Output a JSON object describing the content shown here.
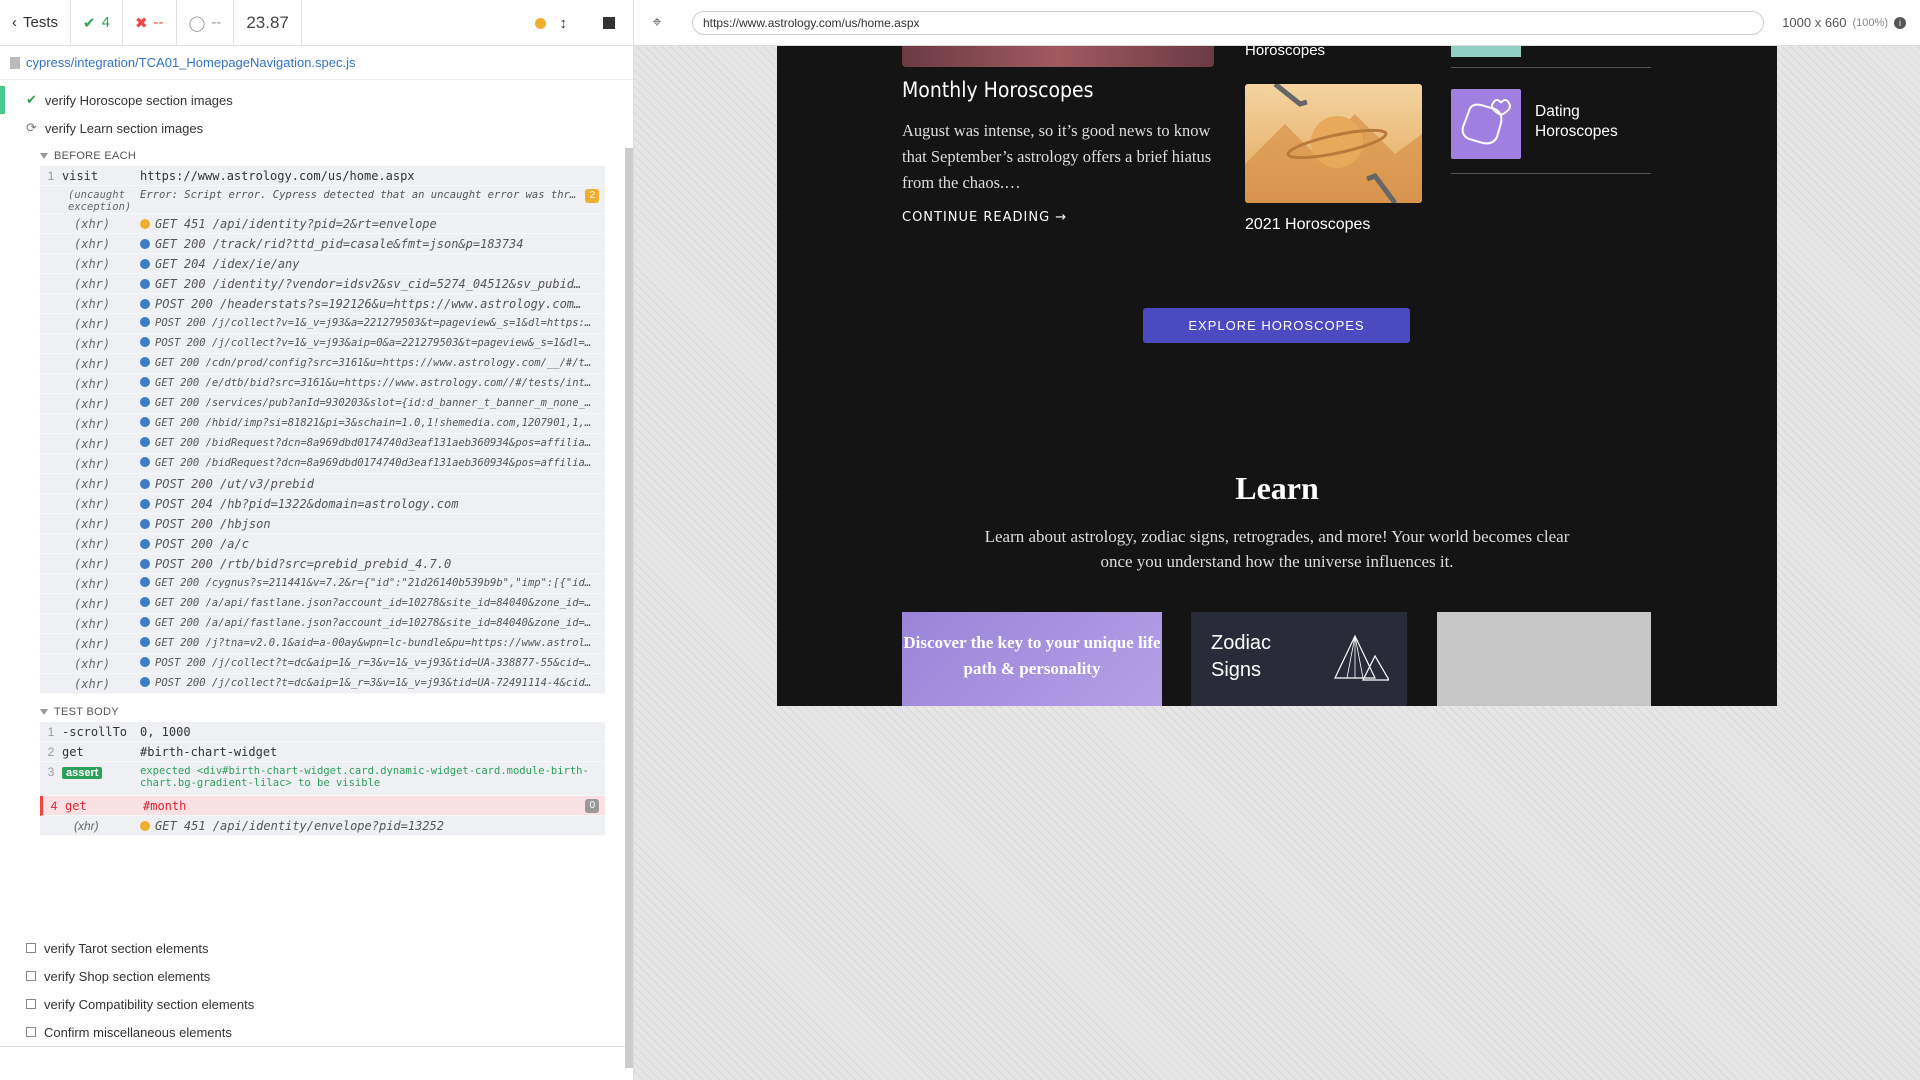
{
  "runner": {
    "tests_label": "Tests",
    "passed": "4",
    "failed": "--",
    "pending": "--",
    "duration": "23.87",
    "spec_file": "cypress/integration/TCA01_HomepageNavigation.spec.js"
  },
  "suites": {
    "passed_test": "verify Horoscope section images",
    "running_test": "verify Learn section images",
    "before_each_label": "BEFORE EACH",
    "test_body_label": "TEST BODY"
  },
  "before_each": [
    {
      "num": "1",
      "name": "visit",
      "msg": "https://www.astrology.com/us/home.aspx",
      "type": "cmd"
    },
    {
      "num": "",
      "name": "(uncaught exception)",
      "msg": "Error: Script error. Cypress detected that an uncaught error was throw…",
      "badge": "2",
      "type": "exc"
    },
    {
      "name": "(xhr)",
      "msg": "GET 451 /api/identity?pid=2&rt=envelope",
      "dot": "orange",
      "type": "xhr"
    },
    {
      "name": "(xhr)",
      "msg": "GET 200 /track/rid?ttd_pid=casale&fmt=json&p=183734",
      "dot": "blue",
      "type": "xhr"
    },
    {
      "name": "(xhr)",
      "msg": "GET 204 /idex/ie/any",
      "dot": "blue",
      "type": "xhr"
    },
    {
      "name": "(xhr)",
      "msg": "GET 200 /identity/?vendor=idsv2&sv_cid=5274_04512&sv_pubid…",
      "dot": "blue",
      "type": "xhr"
    },
    {
      "name": "(xhr)",
      "msg": "POST 200 /headerstats?s=192126&u=https://www.astrology.com…",
      "dot": "blue",
      "type": "xhr"
    },
    {
      "name": "(xhr)",
      "msg": "POST 200 /j/collect?v=1&_v=j93&a=221279503&t=pageview&_s=1&dl=https:/…",
      "dot": "blue",
      "type": "xhr-small"
    },
    {
      "name": "(xhr)",
      "msg": "POST 200 /j/collect?v=1&_v=j93&aip=0&a=221279503&t=pageview&_s=1&dl=h…",
      "dot": "blue",
      "type": "xhr-small"
    },
    {
      "name": "(xhr)",
      "msg": "GET 200 /cdn/prod/config?src=3161&u=https://www.astrology.com/__/#/te…",
      "dot": "blue",
      "type": "xhr-small"
    },
    {
      "name": "(xhr)",
      "msg": "GET 200 /e/dtb/bid?src=3161&u=https://www.astrology.com//#/tests/inte…",
      "dot": "blue",
      "type": "xhr-small"
    },
    {
      "name": "(xhr)",
      "msg": "GET 200 /services/pub?anId=930203&slot={id:d_banner_t_banner_m_none_1…",
      "dot": "blue",
      "type": "xhr-small"
    },
    {
      "name": "(xhr)",
      "msg": "GET 200 /hbid/imp?si=81821&pi=3&schain=1.0,1!shemedia.com,1207901,1,…",
      "dot": "blue",
      "type": "xhr-small"
    },
    {
      "name": "(xhr)",
      "msg": "GET 200 /bidRequest?dcn=8a969dbd0174740d3eaf131aeb360934&pos=affiliat…",
      "dot": "blue",
      "type": "xhr-small"
    },
    {
      "name": "(xhr)",
      "msg": "GET 200 /bidRequest?dcn=8a969dbd0174740d3eaf131aeb360934&pos=affiliat…",
      "dot": "blue",
      "type": "xhr-small"
    },
    {
      "name": "(xhr)",
      "msg": "POST 200 /ut/v3/prebid",
      "dot": "blue",
      "type": "xhr"
    },
    {
      "name": "(xhr)",
      "msg": "POST 204 /hb?pid=1322&domain=astrology.com",
      "dot": "blue",
      "type": "xhr"
    },
    {
      "name": "(xhr)",
      "msg": "POST 200 /hbjson",
      "dot": "blue",
      "type": "xhr"
    },
    {
      "name": "(xhr)",
      "msg": "POST 200 /a/c",
      "dot": "blue",
      "type": "xhr"
    },
    {
      "name": "(xhr)",
      "msg": "POST 200 /rtb/bid?src=prebid_prebid_4.7.0",
      "dot": "blue",
      "type": "xhr"
    },
    {
      "name": "(xhr)",
      "msg": "GET 200 /cygnus?s=211441&v=7.2&r={\"id\":\"21d26140b539b9b\",\"imp\":[{\"id\"…",
      "dot": "blue",
      "type": "xhr-small"
    },
    {
      "name": "(xhr)",
      "msg": "GET 200 /a/api/fastlane.json?account_id=10278&site_id=84040&zone_id=7…",
      "dot": "blue",
      "type": "xhr-small"
    },
    {
      "name": "(xhr)",
      "msg": "GET 200 /a/api/fastlane.json?account_id=10278&site_id=84040&zone_id=7…",
      "dot": "blue",
      "type": "xhr-small"
    },
    {
      "name": "(xhr)",
      "msg": "GET 200 /j?tna=v2.0.1&aid=a-00ay&wpn=lc-bundle&pu=https://www.astrolo…",
      "dot": "blue",
      "type": "xhr-small"
    },
    {
      "name": "(xhr)",
      "msg": "POST 200 /j/collect?t=dc&aip=1&_r=3&v=1&_v=j93&tid=UA-338877-55&cid=1…",
      "dot": "blue",
      "type": "xhr-small"
    },
    {
      "name": "(xhr)",
      "msg": "POST 200 /j/collect?t=dc&aip=1&_r=3&v=1&_v=j93&tid=UA-72491114-4&cid=…",
      "dot": "blue",
      "type": "xhr-small"
    }
  ],
  "test_body": {
    "c1_num": "1",
    "c1_name": "-scrollTo",
    "c1_msg": "0, 1000",
    "c2_num": "2",
    "c2_name": "get",
    "c2_msg": "#birth-chart-widget",
    "c3_num": "3",
    "c3_name": "assert",
    "c3_msg": "expected <div#birth-chart-widget.card.dynamic-widget-card.module-birth-chart.bg-gradient-lilac> to be visible",
    "c4_num": "4",
    "c4_name": "get",
    "c4_msg": "#month",
    "c4_badge": "0",
    "c5_name": "(xhr)",
    "c5_msg": "GET 451 /api/identity/envelope?pid=13252"
  },
  "pending_tests": [
    "verify Tarot section elements",
    "verify Shop section elements",
    "verify Compatibility section elements",
    "Confirm miscellaneous elements"
  ],
  "browser": {
    "url": "https://www.astrology.com/us/home.aspx",
    "viewport": "1000 x 660",
    "zoom": "(100%)"
  },
  "app": {
    "horoscopes_top": "Horoscopes",
    "monthly_title": "Monthly Horoscopes",
    "monthly_desc": "August was intense, so it’s good news to know that September’s astrology offers a brief hiatus from the chaos.…",
    "continue": "CONTINUE READING →",
    "y2021": "2021 Horoscopes",
    "dating": "Dating Horoscopes",
    "explore": "EXPLORE HOROSCOPES",
    "learn_title": "Learn",
    "learn_desc": "Learn about astrology, zodiac signs, retrogrades, and more! Your world becomes clear once you understand how the universe influences it.",
    "card_birth": "Discover the key to your unique life path & personality",
    "card_zodiac": "Zodiac Signs"
  },
  "colors": {
    "pass": "#2e9f5b",
    "fail": "#e44444",
    "xhr_ok": "#3f7cc8",
    "xhr_warn": "#f0ad2e",
    "app_bg": "#141414",
    "explore_btn": "#4b4ac0"
  }
}
